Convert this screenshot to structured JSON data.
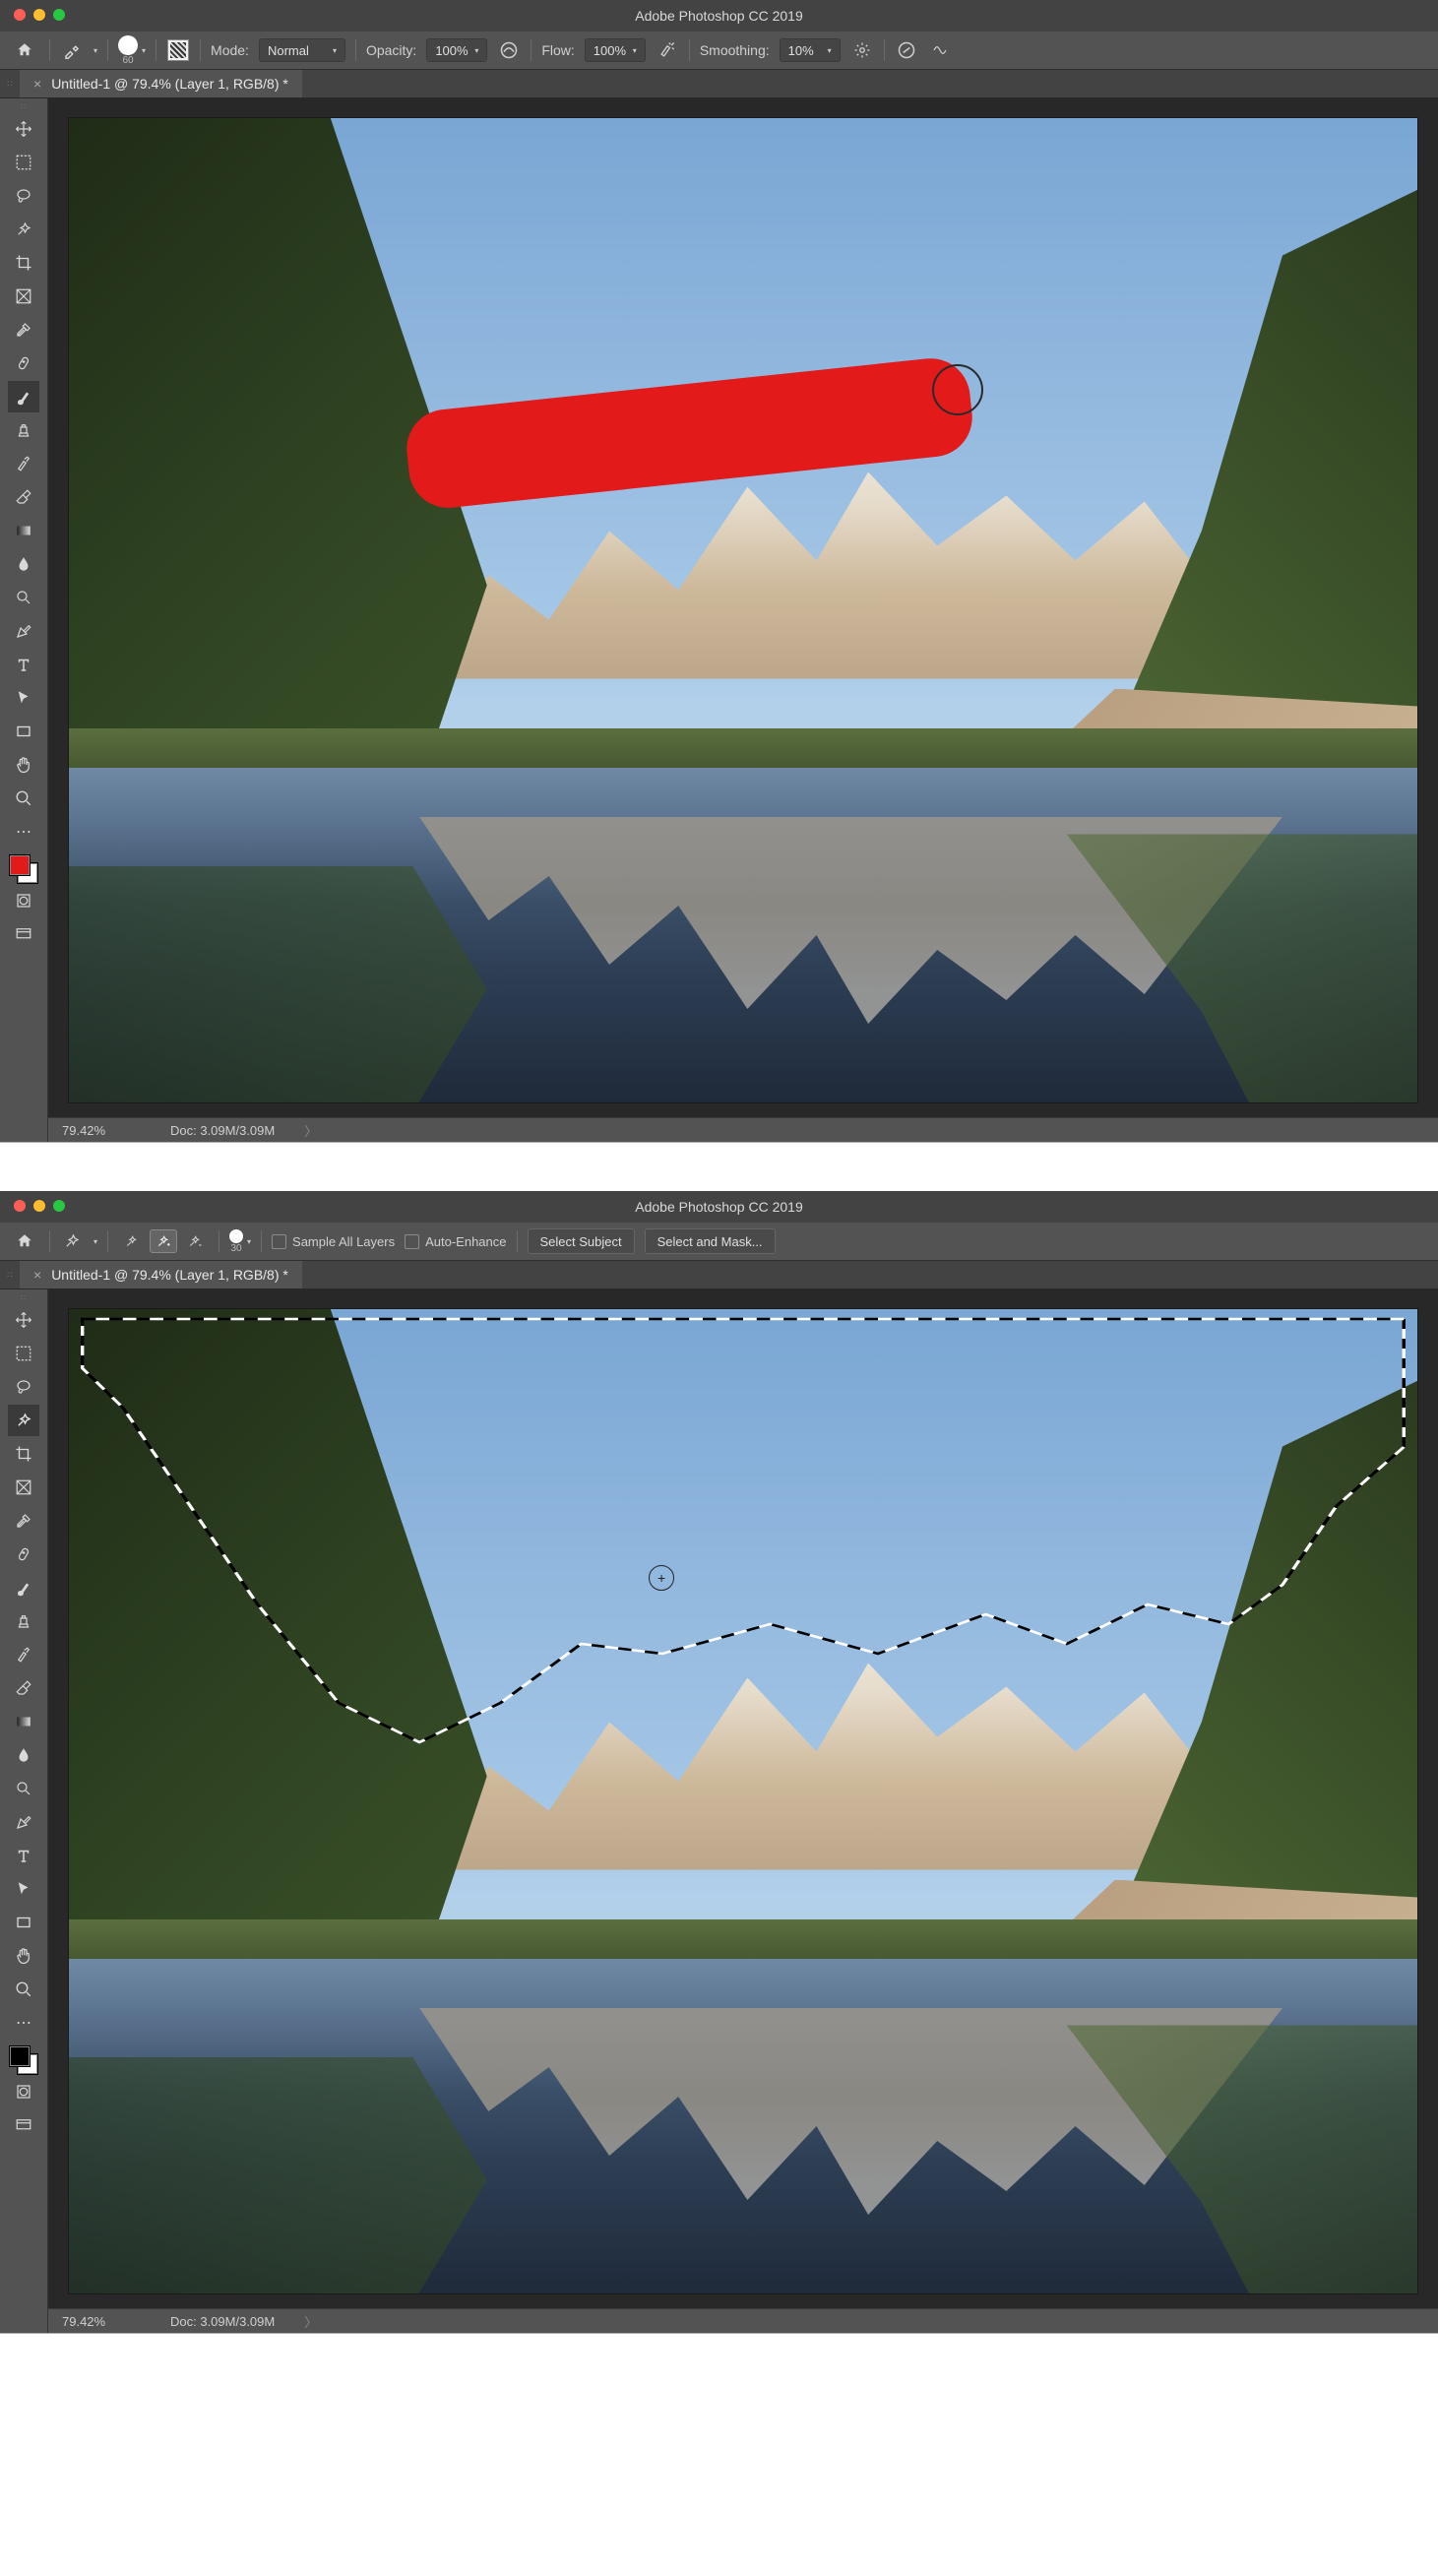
{
  "app_title": "Adobe Photoshop CC 2019",
  "window1": {
    "options": {
      "brush_size": "60",
      "mode_label": "Mode:",
      "mode_value": "Normal",
      "opacity_label": "Opacity:",
      "opacity_value": "100%",
      "flow_label": "Flow:",
      "flow_value": "100%",
      "smoothing_label": "Smoothing:",
      "smoothing_value": "10%"
    },
    "tab": {
      "title": "Untitled-1 @ 79.4% (Layer 1, RGB/8) *"
    },
    "status": {
      "zoom": "79.42%",
      "doc": "Doc: 3.09M/3.09M"
    },
    "swatches": {
      "fg": "#e21a1a",
      "bg": "#ffffff"
    },
    "active_tool": "brush"
  },
  "window2": {
    "options": {
      "brush_size": "30",
      "sample_all_label": "Sample All Layers",
      "auto_enhance_label": "Auto-Enhance",
      "select_subject_label": "Select Subject",
      "select_mask_label": "Select and Mask..."
    },
    "tab": {
      "title": "Untitled-1 @ 79.4% (Layer 1, RGB/8) *"
    },
    "status": {
      "zoom": "79.42%",
      "doc": "Doc: 3.09M/3.09M"
    },
    "swatches": {
      "fg": "#000000",
      "bg": "#ffffff"
    },
    "active_tool": "quick-selection"
  }
}
